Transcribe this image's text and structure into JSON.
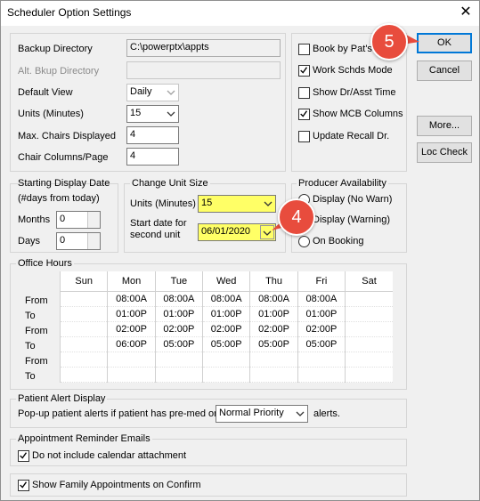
{
  "window": {
    "title": "Scheduler Option Settings",
    "close_glyph": "✕"
  },
  "settings": {
    "backup_directory": {
      "label": "Backup Directory",
      "value": "C:\\powerptx\\appts"
    },
    "alt_backup_directory": {
      "label": "Alt. Bkup Directory",
      "value": ""
    },
    "default_view": {
      "label": "Default View",
      "value": "Daily"
    },
    "units": {
      "label": "Units (Minutes)",
      "value": "15"
    },
    "max_chairs": {
      "label": "Max. Chairs Displayed",
      "value": "4"
    },
    "chair_columns": {
      "label": "Chair Columns/Page",
      "value": "4"
    }
  },
  "checkboxes": [
    {
      "label": "Book by Pat's",
      "checked": false
    },
    {
      "label": "Work Schds Mode",
      "checked": true
    },
    {
      "label": "Show Dr/Asst Time",
      "checked": false
    },
    {
      "label": "Show MCB Columns",
      "checked": true
    },
    {
      "label": "Update Recall Dr.",
      "checked": false
    }
  ],
  "buttons": {
    "ok": "OK",
    "cancel": "Cancel",
    "more": "More...",
    "loc_check": "Loc Check"
  },
  "starting_display": {
    "title": "Starting Display Date",
    "subtitle": "(#days from today)",
    "months_label": "Months",
    "months_value": "0",
    "days_label": "Days",
    "days_value": "0"
  },
  "change_unit": {
    "title": "Change Unit Size",
    "units_label": "Units (Minutes)",
    "units_value": "15",
    "start_label_1": "Start date for",
    "start_label_2": "second unit",
    "start_value": "06/01/2020"
  },
  "producer": {
    "title": "Producer Availability",
    "options": [
      {
        "label": "Display (No Warn)",
        "selected": false
      },
      {
        "label": "Display (Warning)",
        "selected": false
      },
      {
        "label": "On Booking",
        "selected": false
      }
    ]
  },
  "office_hours": {
    "title": "Office Hours",
    "days": [
      "Sun",
      "Mon",
      "Tue",
      "Wed",
      "Thu",
      "Fri",
      "Sat"
    ],
    "rows": [
      {
        "label": "From",
        "cells": [
          "",
          "08:00A",
          "08:00A",
          "08:00A",
          "08:00A",
          "08:00A",
          ""
        ]
      },
      {
        "label": "To",
        "cells": [
          "",
          "01:00P",
          "01:00P",
          "01:00P",
          "01:00P",
          "01:00P",
          ""
        ]
      },
      {
        "label": "From",
        "cells": [
          "",
          "02:00P",
          "02:00P",
          "02:00P",
          "02:00P",
          "02:00P",
          ""
        ]
      },
      {
        "label": "To",
        "cells": [
          "",
          "06:00P",
          "05:00P",
          "05:00P",
          "05:00P",
          "05:00P",
          ""
        ]
      },
      {
        "label": "From",
        "cells": [
          "",
          "",
          "",
          "",
          "",
          "",
          ""
        ]
      },
      {
        "label": "To",
        "cells": [
          "",
          "",
          "",
          "",
          "",
          "",
          ""
        ]
      }
    ]
  },
  "patient_alert": {
    "title": "Patient Alert Display",
    "text_before": "Pop-up patient alerts if patient has pre-med or",
    "priority_value": "Normal Priority",
    "text_after": "alerts."
  },
  "reminder_emails": {
    "title": "Appointment Reminder Emails",
    "no_attachment": {
      "label": "Do not include calendar attachment",
      "checked": true
    }
  },
  "show_family": {
    "label": "Show Family Appointments on Confirm",
    "checked": true
  },
  "callouts": {
    "step4": "4",
    "step5": "5"
  },
  "colors": {
    "highlight": "#ffff66",
    "callout": "#e84c3d",
    "accent": "#0078d7"
  }
}
